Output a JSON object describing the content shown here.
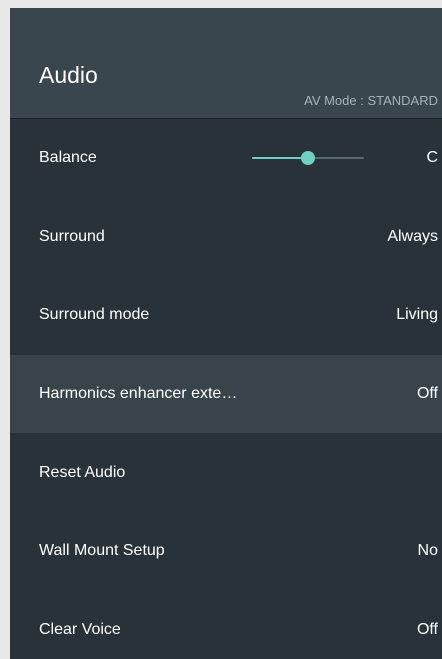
{
  "header": {
    "title": "Audio",
    "av_mode": "AV Mode : STANDARD"
  },
  "colors": {
    "panel_background": "#283238",
    "header_background": "#39464d",
    "selected_row": "#38444a",
    "accent": "#6fd0c3"
  },
  "rows": [
    {
      "label": "Balance",
      "value": "C",
      "slider_level": 0.5
    },
    {
      "label": "Surround",
      "value": "Always"
    },
    {
      "label": "Surround mode",
      "value": "Living"
    },
    {
      "label": "Harmonics enhancer exte…",
      "value": "Off",
      "selected": true
    },
    {
      "label": "Reset Audio",
      "value": ""
    },
    {
      "label": "Wall Mount Setup",
      "value": "No"
    },
    {
      "label": "Clear Voice",
      "value": "Off"
    }
  ]
}
